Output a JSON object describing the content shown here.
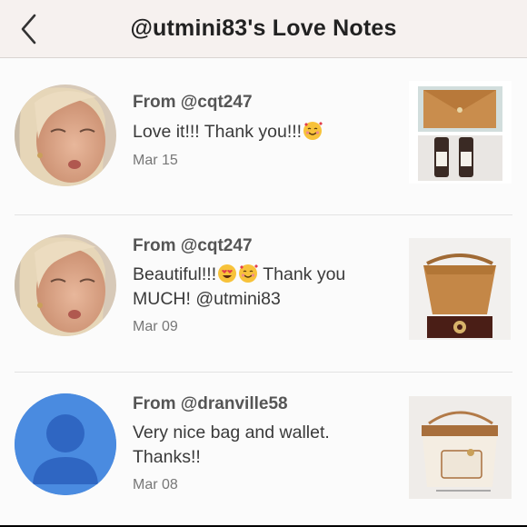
{
  "header": {
    "title": "@utmini83's Love Notes",
    "back_icon": "chevron-left-icon"
  },
  "notes": [
    {
      "from": "From @cqt247",
      "message": "Love it!!! Thank you!!!",
      "message_emoji": [
        "smiling-face-with-hearts"
      ],
      "date": "Mar 15",
      "avatar": "user-photo"
    },
    {
      "from": "From @cqt247",
      "message_line1": "Beautiful!!!",
      "message_emoji": [
        "heart-eyes",
        "smiling-face-with-hearts"
      ],
      "message_line1_tail": "Thank you",
      "message_line2": "MUCH! @utmini83",
      "date": "Mar 09",
      "avatar": "user-photo"
    },
    {
      "from": "From @dranville58",
      "message_line1": "Very nice bag and wallet.",
      "message_line2": "Thanks!!",
      "date": "Mar 08",
      "avatar": "default-user-icon"
    }
  ],
  "colors": {
    "header_bg": "#f6f1ef",
    "default_avatar_bg": "#3a7bd5",
    "default_avatar_fg": "#cfe0f8"
  }
}
